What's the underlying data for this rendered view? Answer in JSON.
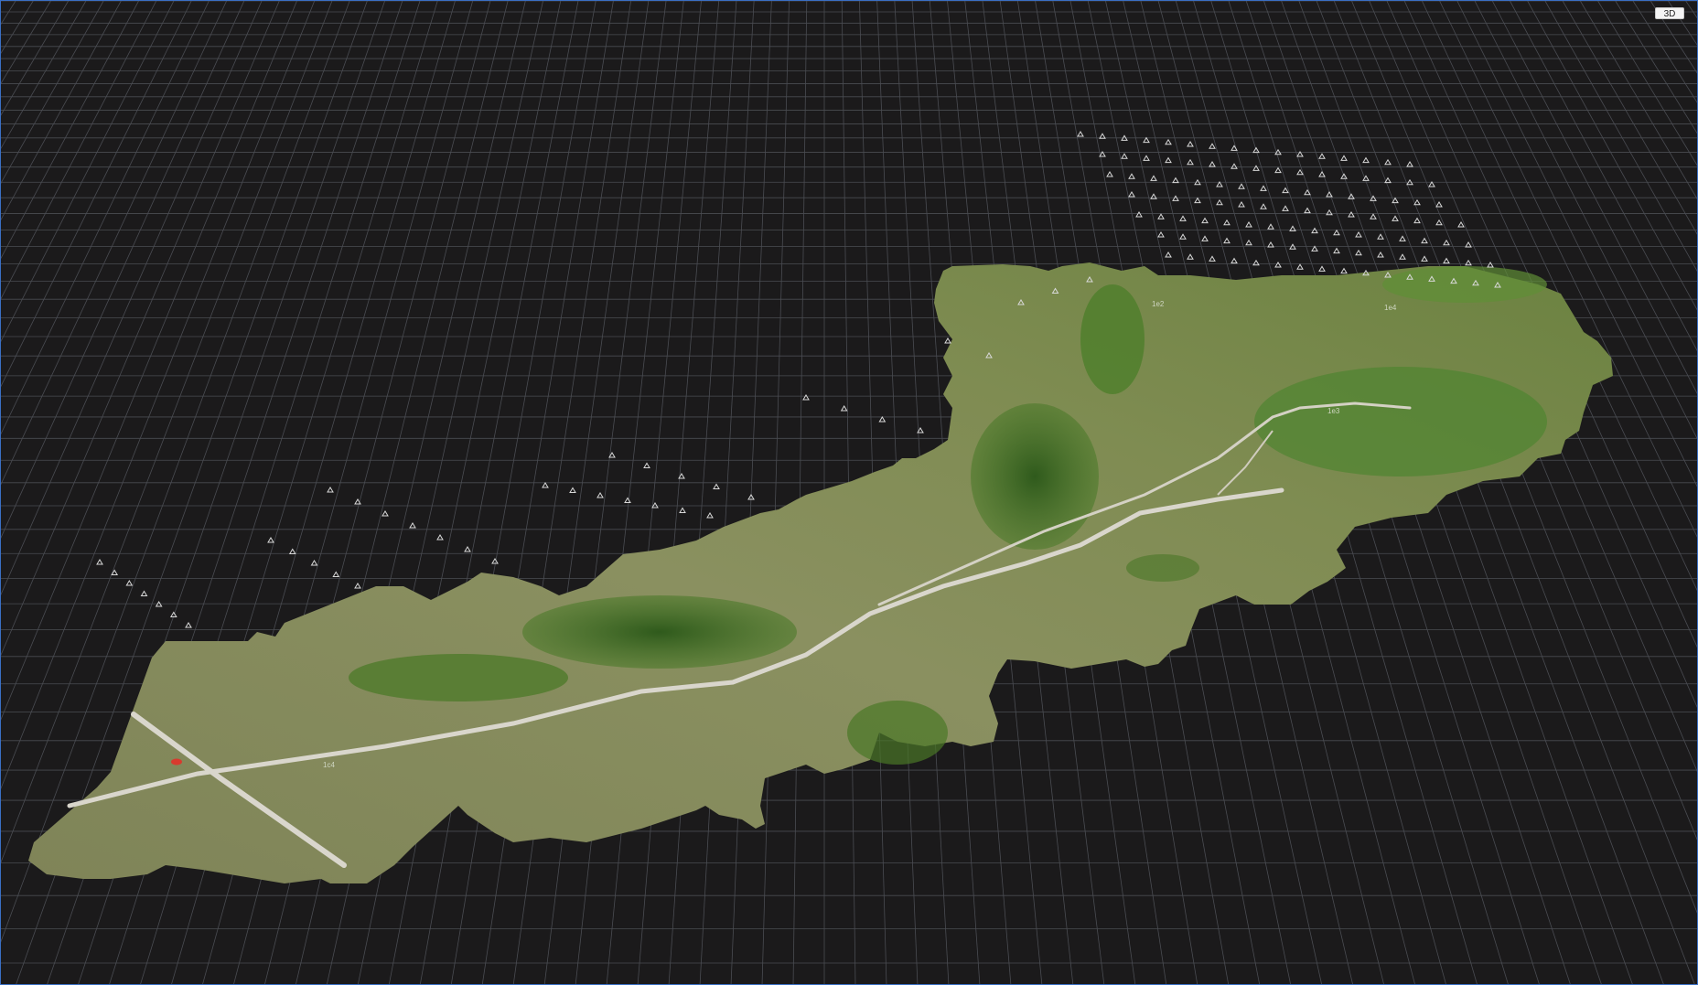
{
  "viewer": {
    "mode_label": "3D",
    "colors": {
      "background": "#1b1a1b",
      "grid": "#4a4c52",
      "frame": "#3a6fc4",
      "terrain_light": "#8f9466",
      "terrain_dark": "#55722f",
      "vegetation": "#3d6b22",
      "path": "#d9d6cc",
      "camera_marker": "#d8d8d8"
    },
    "icons": [
      "camera-position-icon",
      "car-marker-icon"
    ],
    "markers": {
      "camera_count_visible": 150
    }
  }
}
